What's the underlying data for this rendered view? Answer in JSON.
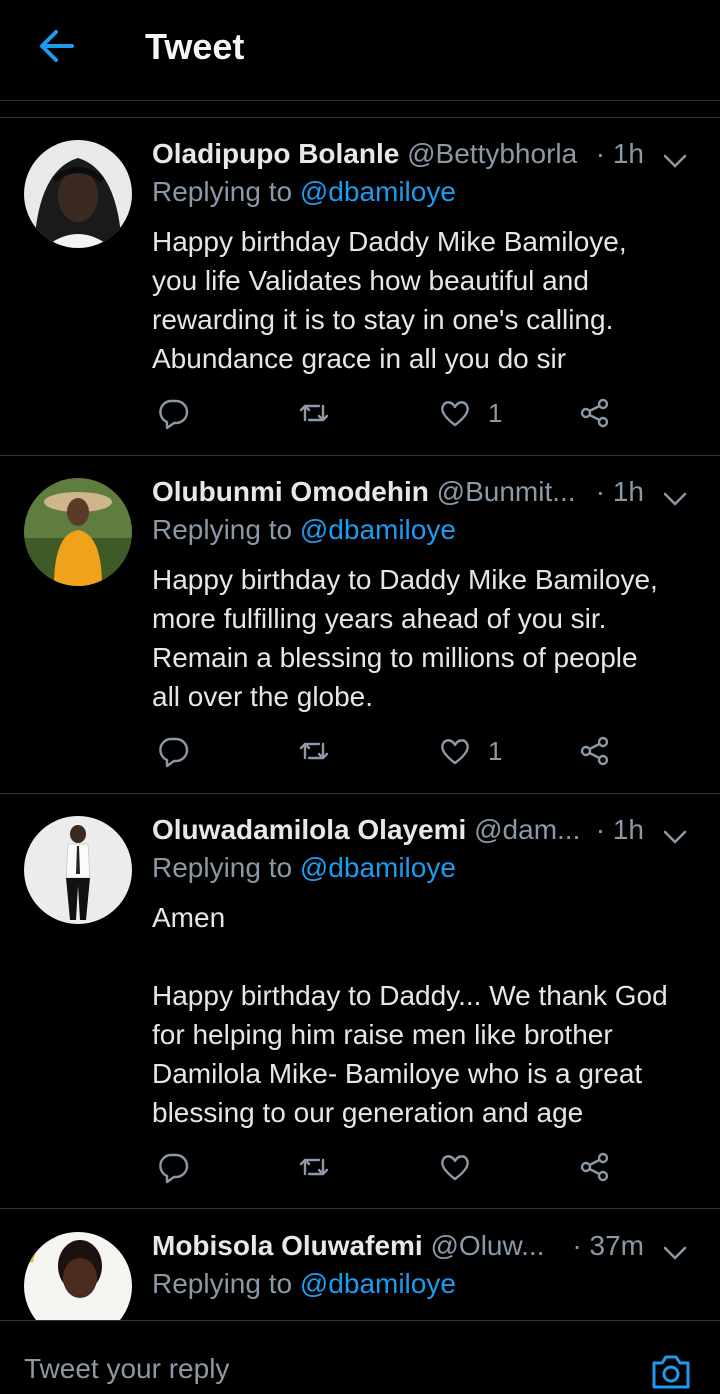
{
  "header": {
    "title": "Tweet"
  },
  "tweets": [
    {
      "name": "Oladipupo Bolanle",
      "handle": "@Bettybhorla",
      "time": "· 1h",
      "replying_prefix": "Replying to",
      "replying_to": "@dbamiloye",
      "text": "Happy birthday Daddy Mike Bamiloye,\nyou life Validates how beautiful and\nrewarding it is to stay in one's calling.\nAbundance grace in all you do sir",
      "likes": "1"
    },
    {
      "name": "Olubunmi Omodehin",
      "handle": "@Bunmit...",
      "time": "· 1h",
      "replying_prefix": "Replying to",
      "replying_to": "@dbamiloye",
      "text": "Happy birthday to Daddy Mike Bamiloye,\nmore fulfilling years ahead of you sir.\nRemain a blessing to millions of people\nall over the globe.",
      "likes": "1"
    },
    {
      "name": "Oluwadamilola Olayemi",
      "handle": "@dam...",
      "time": "· 1h",
      "replying_prefix": "Replying to",
      "replying_to": "@dbamiloye",
      "text": "Amen\n\nHappy birthday to Daddy... We thank God\nfor helping him raise men like brother\nDamilola Mike- Bamiloye who is a great\nblessing to our generation and age",
      "likes": ""
    },
    {
      "name": "Mobisola Oluwafemi",
      "handle": "@Oluw...",
      "time": "· 37m",
      "replying_prefix": "Replying to",
      "replying_to": "@dbamiloye"
    }
  ],
  "composer": {
    "placeholder": "Tweet your reply"
  },
  "icons": {
    "back": "arrow-left-icon",
    "more": "chevron-down-icon",
    "reply": "comment-icon",
    "retweet": "retweet-icon",
    "like": "heart-icon",
    "share": "share-icon",
    "camera": "camera-icon"
  },
  "colors": {
    "accent": "#1d9bf0",
    "muted": "#8b98a5",
    "background": "#000000"
  }
}
